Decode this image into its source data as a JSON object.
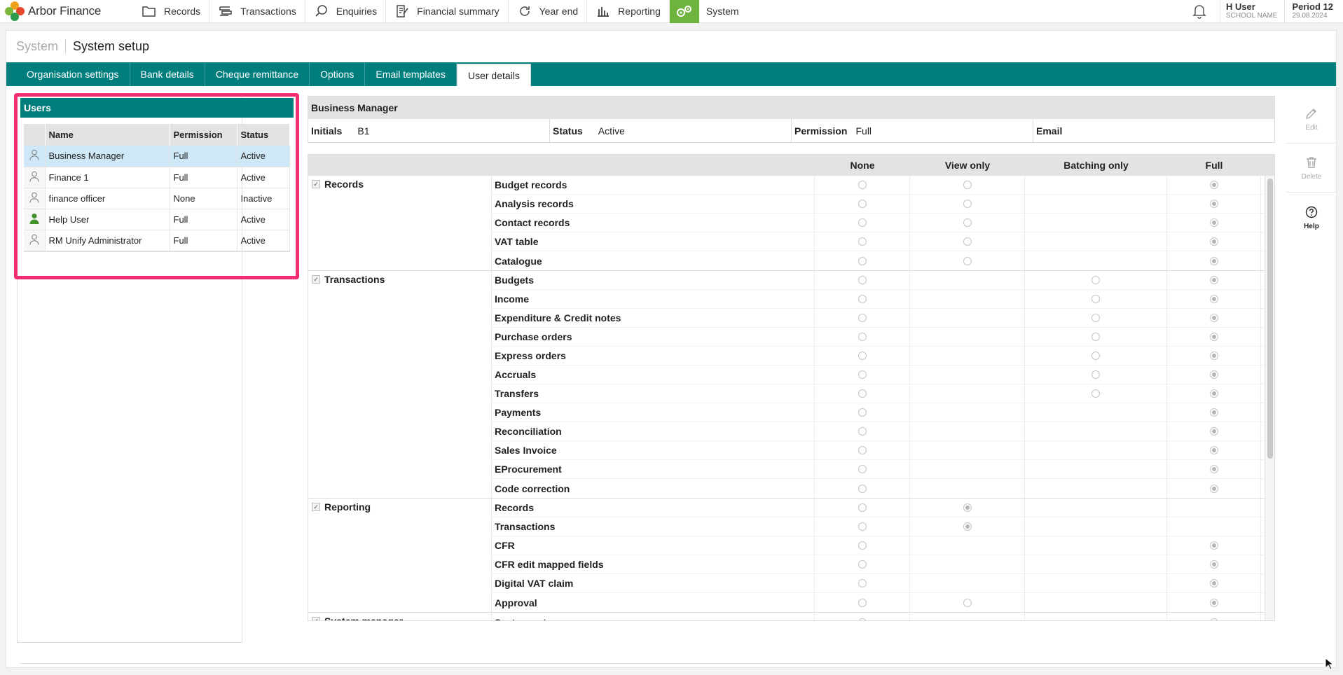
{
  "app": {
    "name": "Arbor Finance"
  },
  "nav": [
    {
      "label": "Records",
      "icon": "folder-icon"
    },
    {
      "label": "Transactions",
      "icon": "transactions-icon"
    },
    {
      "label": "Enquiries",
      "icon": "search-icon"
    },
    {
      "label": "Financial summary",
      "icon": "document-edit-icon"
    },
    {
      "label": "Year end",
      "icon": "refresh-icon"
    },
    {
      "label": "Reporting",
      "icon": "bar-chart-icon"
    },
    {
      "label": "System",
      "icon": "gears-icon",
      "active": true
    }
  ],
  "user": {
    "name": "H User",
    "school": "SCHOOL NAME"
  },
  "period": {
    "label": "Period 12",
    "date": "29.08.2024"
  },
  "breadcrumb": {
    "section": "System",
    "page": "System setup"
  },
  "tabs": [
    "Organisation settings",
    "Bank details",
    "Cheque remittance",
    "Options",
    "Email templates",
    "User details"
  ],
  "active_tab": "User details",
  "users": {
    "title": "Users",
    "columns": [
      "Name",
      "Permission",
      "Status"
    ],
    "rows": [
      {
        "name": "Business Manager",
        "permission": "Full",
        "status": "Active",
        "selected": true,
        "icon": "user-outline-icon"
      },
      {
        "name": "Finance 1",
        "permission": "Full",
        "status": "Active",
        "icon": "user-outline-icon"
      },
      {
        "name": "finance officer",
        "permission": "None",
        "status": "Inactive",
        "icon": "user-outline-icon"
      },
      {
        "name": "Help User",
        "permission": "Full",
        "status": "Active",
        "icon": "user-filled-icon"
      },
      {
        "name": "RM Unify Administrator",
        "permission": "Full",
        "status": "Active",
        "icon": "user-outline-icon"
      }
    ]
  },
  "detail": {
    "title": "Business Manager",
    "initials_label": "Initials",
    "initials": "B1",
    "status_label": "Status",
    "status": "Active",
    "permission_label": "Permission",
    "permission": "Full",
    "email_label": "Email",
    "email": ""
  },
  "permissions": {
    "columns": [
      "None",
      "View only",
      "Batching only",
      "Full"
    ],
    "sections": [
      {
        "name": "Records",
        "items": [
          {
            "name": "Budget records",
            "opts": [
              "none",
              "view",
              null,
              "full"
            ],
            "selected": "full"
          },
          {
            "name": "Analysis records",
            "opts": [
              "none",
              "view",
              null,
              "full"
            ],
            "selected": "full"
          },
          {
            "name": "Contact records",
            "opts": [
              "none",
              "view",
              null,
              "full"
            ],
            "selected": "full"
          },
          {
            "name": "VAT table",
            "opts": [
              "none",
              "view",
              null,
              "full"
            ],
            "selected": "full"
          },
          {
            "name": "Catalogue",
            "opts": [
              "none",
              "view",
              null,
              "full"
            ],
            "selected": "full"
          }
        ]
      },
      {
        "name": "Transactions",
        "items": [
          {
            "name": "Budgets",
            "opts": [
              "none",
              null,
              "batch",
              "full"
            ],
            "selected": "full"
          },
          {
            "name": "Income",
            "opts": [
              "none",
              null,
              "batch",
              "full"
            ],
            "selected": "full"
          },
          {
            "name": "Expenditure & Credit notes",
            "opts": [
              "none",
              null,
              "batch",
              "full"
            ],
            "selected": "full"
          },
          {
            "name": "Purchase orders",
            "opts": [
              "none",
              null,
              "batch",
              "full"
            ],
            "selected": "full"
          },
          {
            "name": "Express orders",
            "opts": [
              "none",
              null,
              "batch",
              "full"
            ],
            "selected": "full"
          },
          {
            "name": "Accruals",
            "opts": [
              "none",
              null,
              "batch",
              "full"
            ],
            "selected": "full"
          },
          {
            "name": "Transfers",
            "opts": [
              "none",
              null,
              "batch",
              "full"
            ],
            "selected": "full"
          },
          {
            "name": "Payments",
            "opts": [
              "none",
              null,
              null,
              "full"
            ],
            "selected": "full"
          },
          {
            "name": "Reconciliation",
            "opts": [
              "none",
              null,
              null,
              "full"
            ],
            "selected": "full"
          },
          {
            "name": "Sales Invoice",
            "opts": [
              "none",
              null,
              null,
              "full"
            ],
            "selected": "full"
          },
          {
            "name": "EProcurement",
            "opts": [
              "none",
              null,
              null,
              "full"
            ],
            "selected": "full"
          },
          {
            "name": "Code correction",
            "opts": [
              "none",
              null,
              null,
              "full"
            ],
            "selected": "full"
          }
        ]
      },
      {
        "name": "Reporting",
        "items": [
          {
            "name": "Records",
            "opts": [
              "none",
              "view",
              null,
              null
            ],
            "selected": "view"
          },
          {
            "name": "Transactions",
            "opts": [
              "none",
              "view",
              null,
              null
            ],
            "selected": "view"
          },
          {
            "name": "CFR",
            "opts": [
              "none",
              null,
              null,
              "full"
            ],
            "selected": "full"
          },
          {
            "name": "CFR edit mapped fields",
            "opts": [
              "none",
              null,
              null,
              "full"
            ],
            "selected": "full"
          },
          {
            "name": "Digital VAT claim",
            "opts": [
              "none",
              null,
              null,
              "full"
            ],
            "selected": "full"
          },
          {
            "name": "Approval",
            "opts": [
              "none",
              "view",
              null,
              "full"
            ],
            "selected": "full"
          }
        ]
      },
      {
        "name": "System manager",
        "items": [
          {
            "name": "System setup",
            "opts": [
              "none",
              null,
              null,
              "full"
            ],
            "selected": "full"
          }
        ]
      }
    ]
  },
  "actions": [
    {
      "label": "Edit",
      "icon": "pencil-icon"
    },
    {
      "label": "Delete",
      "icon": "trash-icon"
    },
    {
      "label": "Help",
      "icon": "help-icon"
    }
  ]
}
